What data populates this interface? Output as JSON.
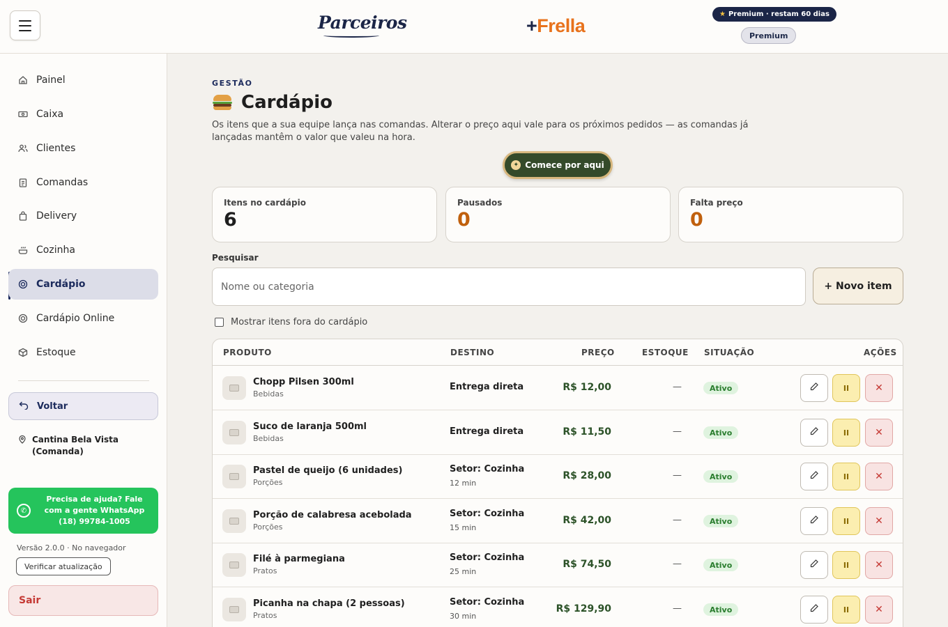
{
  "header": {
    "logo_parceiros": "Parceiros",
    "logo_frella_plus": "+",
    "logo_frella": "Frella",
    "premium_pill": "Premium · restam 60 dias",
    "premium_badge": "Premium"
  },
  "sidebar": {
    "items": [
      {
        "label": "Painel",
        "icon": "home-icon"
      },
      {
        "label": "Caixa",
        "icon": "cash-icon"
      },
      {
        "label": "Clientes",
        "icon": "users-icon"
      },
      {
        "label": "Comandas",
        "icon": "clipboard-icon"
      },
      {
        "label": "Delivery",
        "icon": "bag-icon"
      },
      {
        "label": "Cozinha",
        "icon": "cooking-pot-icon"
      },
      {
        "label": "Cardápio",
        "icon": "target-icon"
      },
      {
        "label": "Cardápio Online",
        "icon": "target-icon"
      },
      {
        "label": "Estoque",
        "icon": "box-icon"
      }
    ],
    "active_item": "Cardápio",
    "back_label": "Voltar",
    "store_name": "Cantina Bela Vista (Comanda)",
    "help_text": "Precisa de ajuda? Fale com a gente WhatsApp (18) 99784-1005",
    "version": "Versão 2.0.0 · No navegador",
    "check_update": "Verificar atualização",
    "logout": "Sair"
  },
  "main": {
    "eyebrow": "GESTÃO",
    "title": "Cardápio",
    "description": "Os itens que a sua equipe lança nas comandas. Alterar o preço aqui vale para os próximos pedidos — as comandas já lançadas mantêm o valor que valeu na hora.",
    "start_button": "Comece por aqui",
    "stats": [
      {
        "label": "Itens no cardápio",
        "value": "6"
      },
      {
        "label": "Pausados",
        "value": "0"
      },
      {
        "label": "Falta preço",
        "value": "0"
      }
    ],
    "search_label": "Pesquisar",
    "search_placeholder": "Nome ou categoria",
    "new_item_button": "+ Novo item",
    "show_all_label": "Mostrar itens fora do cardápio"
  },
  "table": {
    "columns": [
      "PRODUTO",
      "DESTINO",
      "PREÇO",
      "ESTOQUE",
      "SITUAÇÃO",
      "AÇÕES"
    ],
    "rows": [
      {
        "name": "Chopp Pilsen 300ml",
        "category": "Bebidas",
        "destination": "Entrega direta",
        "time": "",
        "price": "R$ 12,00",
        "stock": "—",
        "status": "Ativo"
      },
      {
        "name": "Suco de laranja 500ml",
        "category": "Bebidas",
        "destination": "Entrega direta",
        "time": "",
        "price": "R$ 11,50",
        "stock": "—",
        "status": "Ativo"
      },
      {
        "name": "Pastel de queijo (6 unidades)",
        "category": "Porções",
        "destination": "Setor: Cozinha",
        "time": "12 min",
        "price": "R$ 28,00",
        "stock": "—",
        "status": "Ativo"
      },
      {
        "name": "Porção de calabresa acebolada",
        "category": "Porções",
        "destination": "Setor: Cozinha",
        "time": "15 min",
        "price": "R$ 42,00",
        "stock": "—",
        "status": "Ativo"
      },
      {
        "name": "Filé à parmegiana",
        "category": "Pratos",
        "destination": "Setor: Cozinha",
        "time": "25 min",
        "price": "R$ 74,50",
        "stock": "—",
        "status": "Ativo"
      },
      {
        "name": "Picanha na chapa (2 pessoas)",
        "category": "Pratos",
        "destination": "Setor: Cozinha",
        "time": "30 min",
        "price": "R$ 129,90",
        "stock": "—",
        "status": "Ativo"
      }
    ],
    "action_icons": [
      "pencil-icon",
      "pause-icon",
      "close-icon"
    ]
  },
  "colors": {
    "brand_navy": "#1b2a5c",
    "frella_orange": "#e8721c",
    "whatsapp_green": "#25c45c",
    "status_green": "#2a7d2e",
    "warn_orange": "#c0600d"
  }
}
